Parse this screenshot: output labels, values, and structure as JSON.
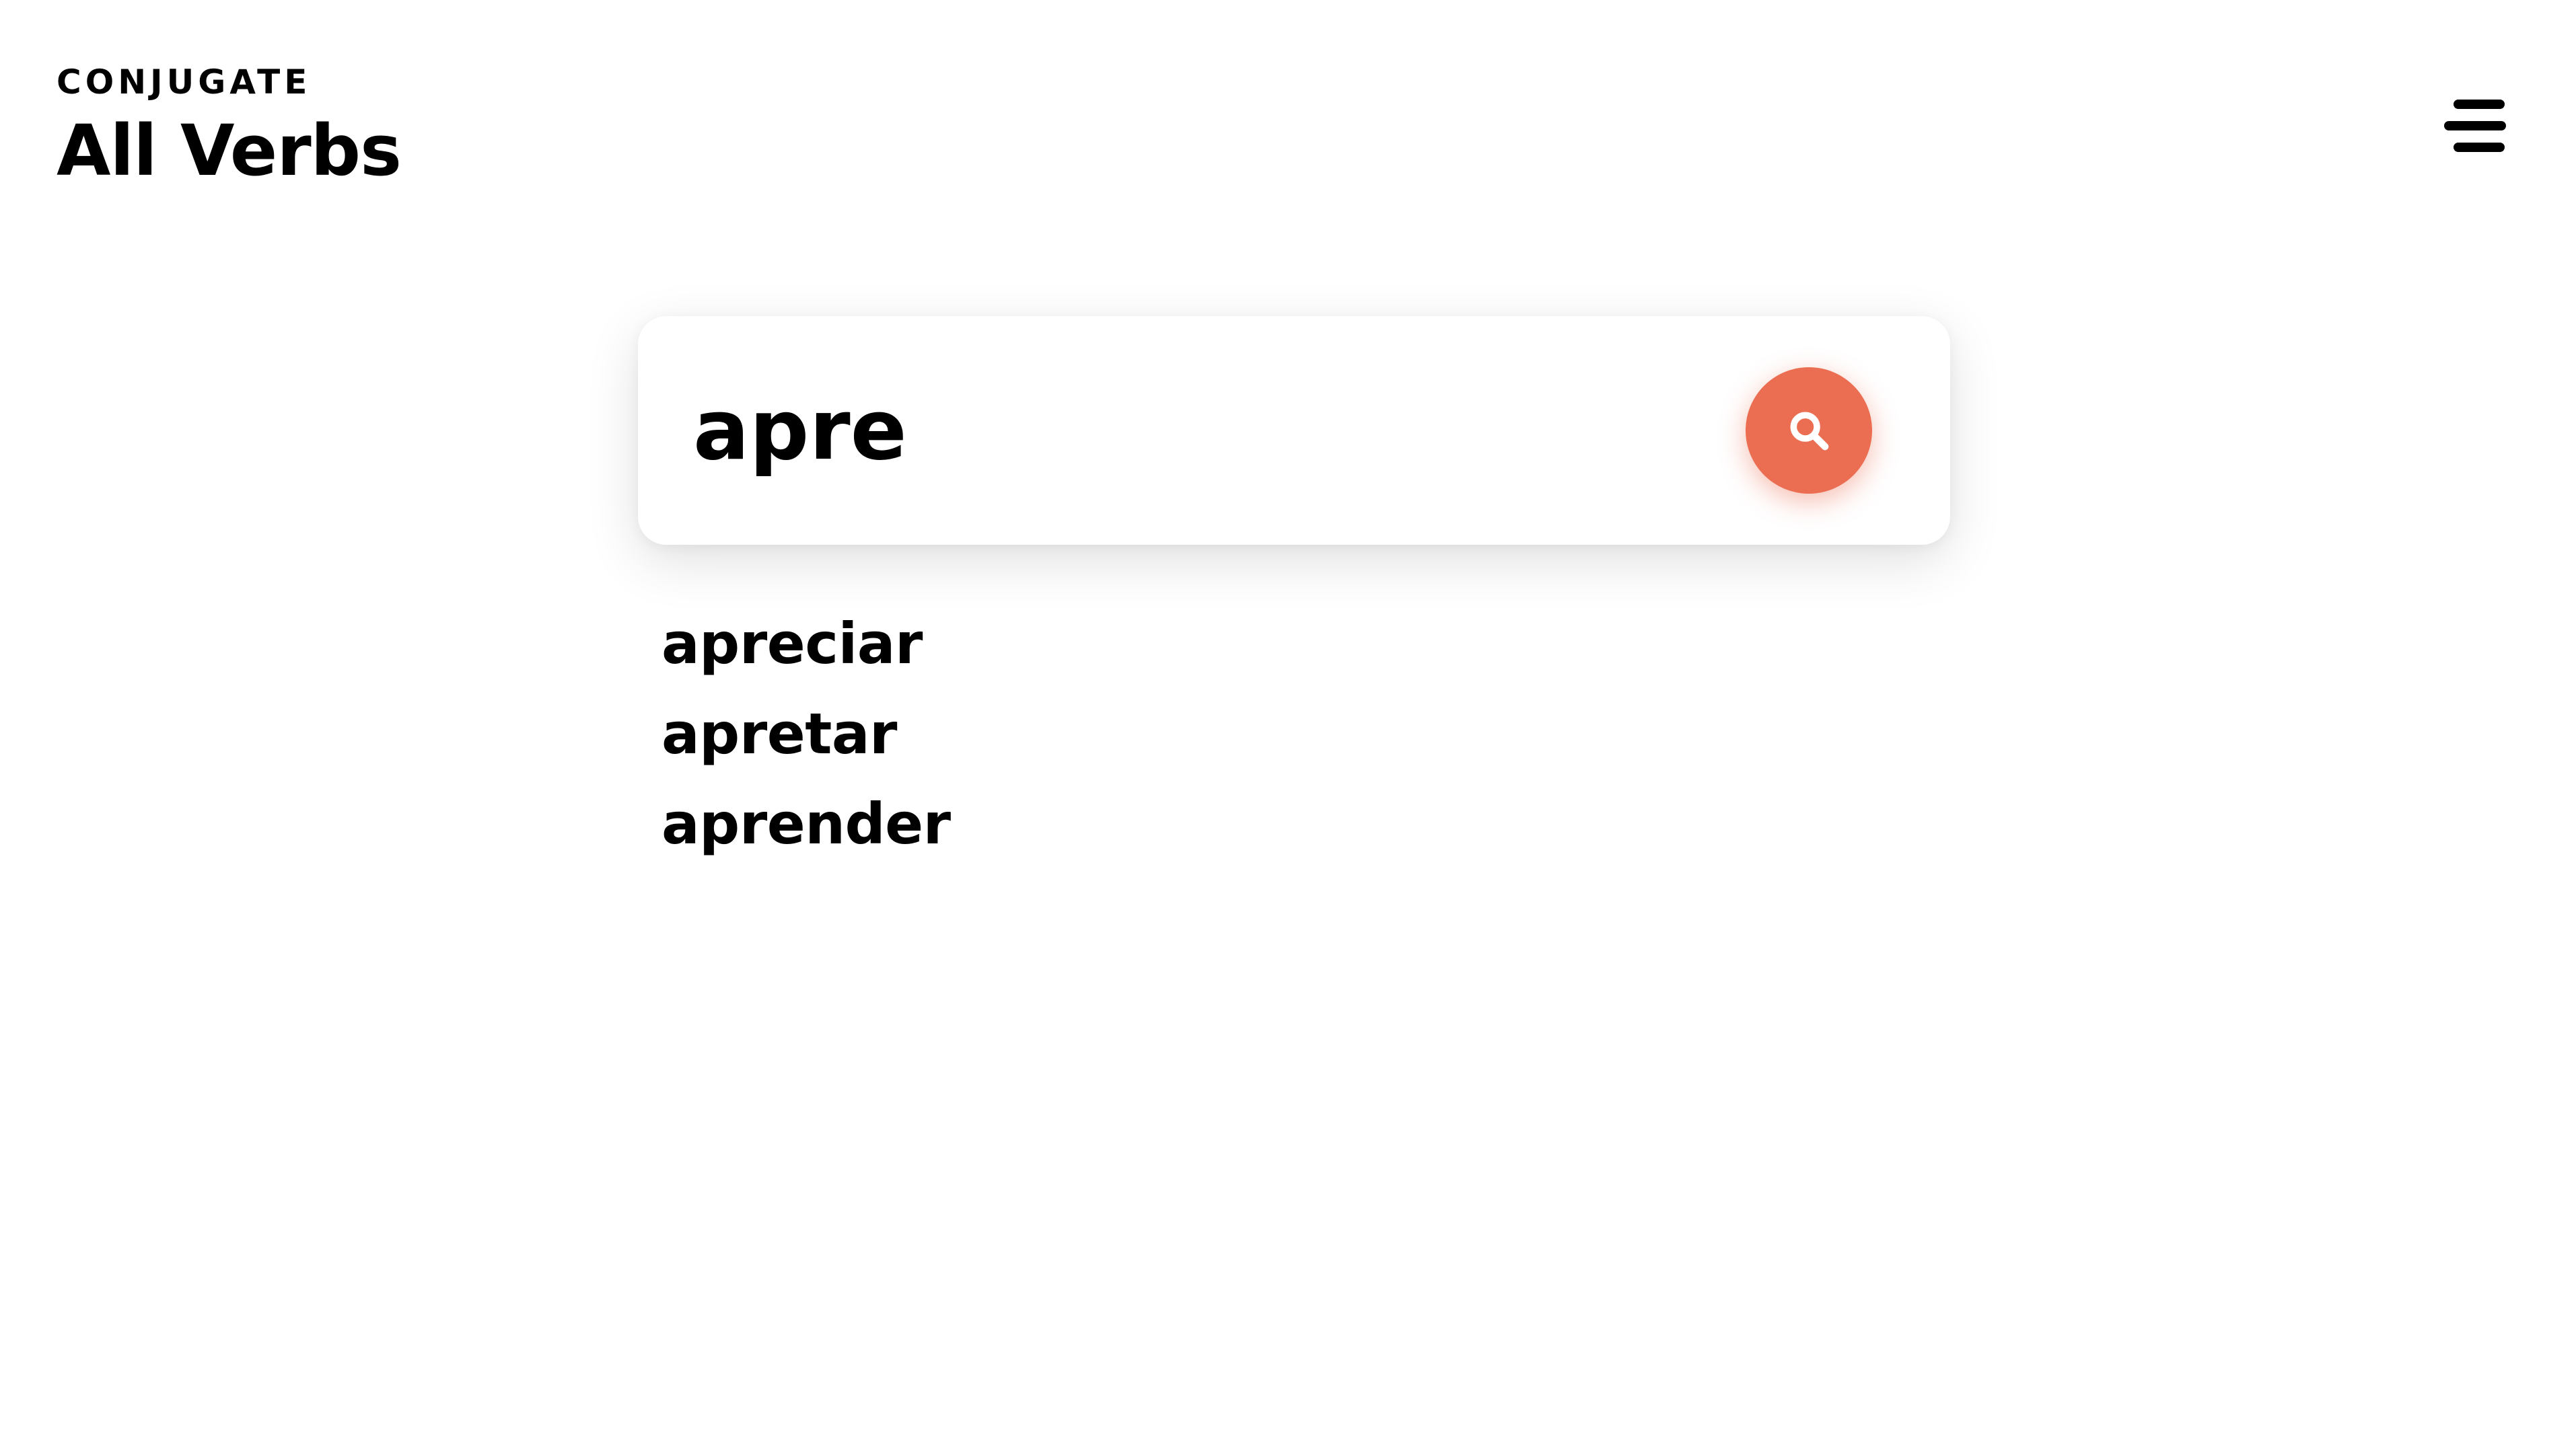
{
  "header": {
    "eyebrow": "CONJUGATE",
    "title": "All Verbs",
    "menu_icon": "hamburger-menu-icon"
  },
  "search": {
    "value": "apre",
    "button_icon": "search-icon",
    "button_color": "#EC6E52"
  },
  "suggestions": [
    {
      "label": "apreciar"
    },
    {
      "label": "apretar"
    },
    {
      "label": "aprender"
    }
  ]
}
